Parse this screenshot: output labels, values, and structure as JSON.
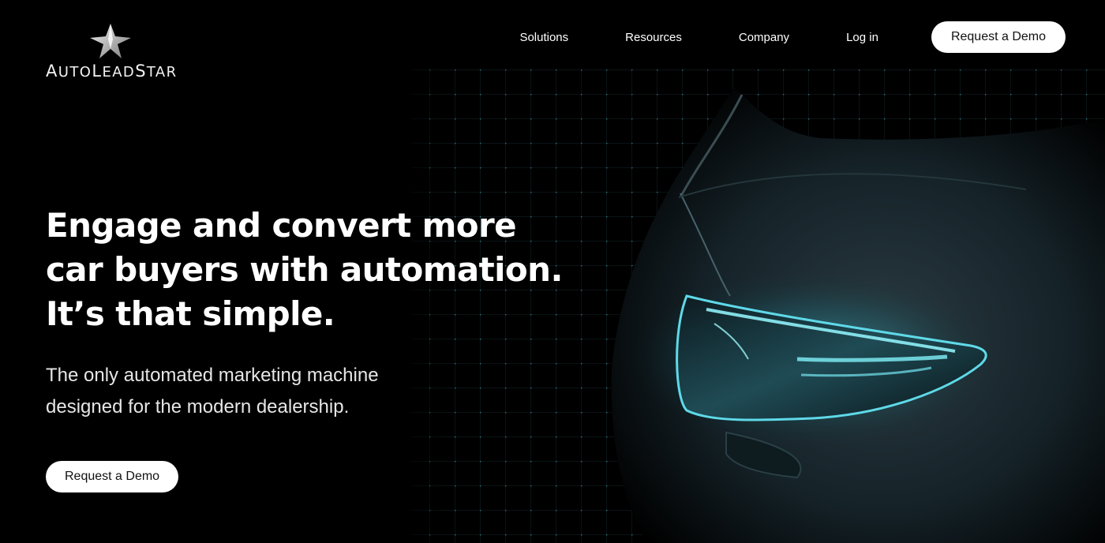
{
  "brand": {
    "name_parts": [
      "A",
      "UTO",
      "L",
      "EAD",
      "S",
      "TAR"
    ]
  },
  "nav": {
    "items": [
      {
        "label": "Solutions"
      },
      {
        "label": "Resources"
      },
      {
        "label": "Company"
      },
      {
        "label": "Log in"
      }
    ],
    "cta_label": "Request a Demo"
  },
  "hero": {
    "headline_lines": [
      "Engage and convert more",
      "car buyers with automation.",
      "It’s that simple."
    ],
    "subhead_lines": [
      "The only automated marketing machine",
      "designed for the modern dealership."
    ],
    "cta_label": "Request a Demo",
    "image": "dark car front with glowing teal headlight over a dotted grid"
  },
  "colors": {
    "background": "#000000",
    "accent_glow": "#3fc6d8",
    "button_bg": "#ffffff",
    "button_text": "#111111"
  }
}
